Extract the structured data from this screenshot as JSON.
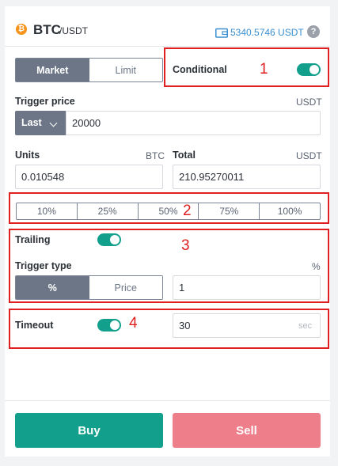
{
  "header": {
    "coin_icon": "bitcoin-icon",
    "coin_glyph": "₿",
    "base": "BTC",
    "quote": "/USDT",
    "balance": "5340.5746 USDT",
    "help_glyph": "?"
  },
  "order_type": {
    "market_label": "Market",
    "limit_label": "Limit",
    "selected": "Market"
  },
  "conditional": {
    "label": "Conditional",
    "enabled": true
  },
  "trigger_price": {
    "label": "Trigger price",
    "unit": "USDT",
    "mode": "Last",
    "value": "20000"
  },
  "units": {
    "label": "Units",
    "unit": "BTC",
    "value": "0.010548"
  },
  "total": {
    "label": "Total",
    "unit": "USDT",
    "value": "210.95270011"
  },
  "percent_options": [
    "10%",
    "25%",
    "50%",
    "75%",
    "100%"
  ],
  "trailing": {
    "label": "Trailing",
    "enabled": true
  },
  "trigger_type": {
    "label": "Trigger type",
    "unit": "%",
    "percent_label": "%",
    "price_label": "Price",
    "selected": "%",
    "value": "1"
  },
  "timeout": {
    "label": "Timeout",
    "enabled": true,
    "value": "30",
    "suffix": "sec"
  },
  "annotations": [
    "1",
    "2",
    "3",
    "4"
  ],
  "actions": {
    "buy_label": "Buy",
    "sell_label": "Sell"
  },
  "colors": {
    "accent_green": "#12a08c",
    "sell_red": "#ee7f8a",
    "annotation_red": "#e02020",
    "balance_blue": "#3a8fd0"
  }
}
